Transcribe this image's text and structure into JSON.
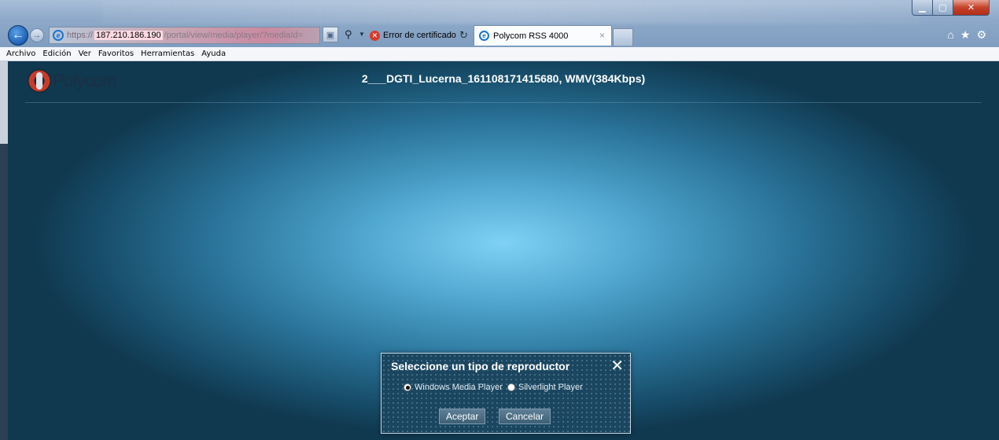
{
  "browser": {
    "url": {
      "protocol": "https://",
      "host": "187.210.186.190",
      "path": "/portal/view/media/player/?mediaId="
    },
    "cert_error": "Error de certificado",
    "tab_title": "Polycom RSS 4000",
    "tab_close": "×",
    "menu": [
      "Archivo",
      "Edición",
      "Ver",
      "Favoritos",
      "Herramientas",
      "Ayuda"
    ],
    "icons": {
      "back": "back-arrow-icon",
      "forward": "forward-arrow-icon",
      "home": "home-icon",
      "favorites": "star-icon",
      "tools": "gear-icon"
    }
  },
  "page": {
    "logo_text": "Polycom",
    "media_title": "2___DGTI_Lucerna_161108171415680, WMV(384Kbps)"
  },
  "dialog": {
    "title": "Seleccione un tipo de reproductor",
    "options": [
      {
        "label": "Windows Media Player",
        "selected": true
      },
      {
        "label": "Silverlight Player",
        "selected": false
      }
    ],
    "accept_label": "Aceptar",
    "cancel_label": "Cancelar"
  }
}
